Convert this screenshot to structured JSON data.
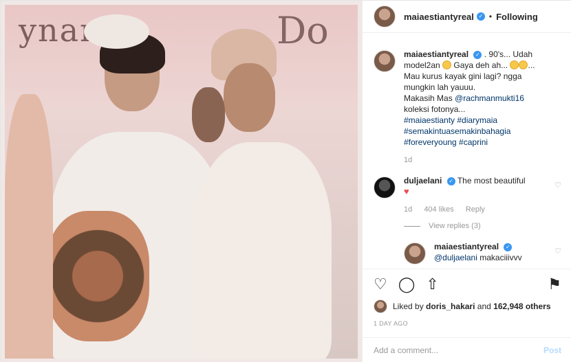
{
  "post": {
    "author": "maiaestiantyreal",
    "follow_state": "Following",
    "separator": "•"
  },
  "photo": {
    "banner_left": "ynami",
    "banner_right": "Do"
  },
  "caption": {
    "username": "maiaestiantyreal",
    "text_1": ". 90's... Udah model2an",
    "text_2": "Gaya deh ah...",
    "text_3": "... Mau kurus kayak gini lagi? ngga mungkin lah yauuu.",
    "text_4": "Makasih Mas",
    "mention": "@rachmanmukti16",
    "text_5": "koleksi fotonya...",
    "hashtags": "#maiaestianty #diarymaia #semakintuasemakinbahagia #foreveryoung #caprini",
    "time": "1d"
  },
  "comment": {
    "username": "duljaelani",
    "text": "The most beautiful",
    "heart": "♥",
    "time": "1d",
    "likes": "404 likes",
    "reply_label": "Reply",
    "view_replies": "View replies (3)"
  },
  "reply": {
    "username": "maiaestiantyreal",
    "mention": "@duljaelani",
    "text": "makaciiivvv"
  },
  "actions": {
    "like_icon": "♡",
    "comment_icon": "◯",
    "share_icon": "⇧",
    "bookmark_icon": "⚑"
  },
  "likes": {
    "prefix": "Liked by",
    "user": "doris_hakari",
    "middle": "and",
    "count": "162,948 others"
  },
  "date": "1 DAY AGO",
  "add_comment": {
    "placeholder": "Add a comment...",
    "post_label": "Post"
  },
  "colors": {
    "verified": "#3897f0",
    "link": "#003569",
    "heart": "#ed4956"
  }
}
